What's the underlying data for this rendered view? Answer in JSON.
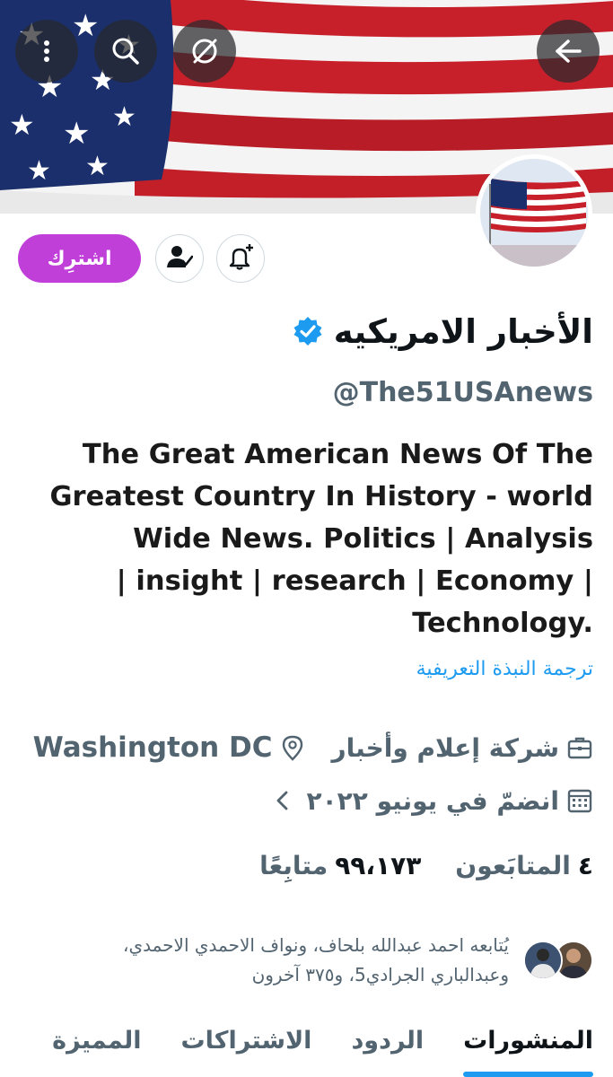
{
  "header": {
    "back_icon": "arrow-right-icon",
    "buttons": [
      "more-vertical-icon",
      "search-icon",
      "translate-off-icon"
    ]
  },
  "profile": {
    "display_name": "الأخبار الامريكيه",
    "handle": "@The51USAnews",
    "verified": true,
    "bio_lines": [
      "The Great American News Of The",
      "Greatest Country In History - world",
      "Wide News. Politics | Analysis",
      "| insight | research | Economy |",
      "Technology."
    ],
    "translate_bio": "ترجمة النبذة التعريفية",
    "category": "شركة إعلام وأخبار",
    "location": "Washington DC",
    "joined": "انضمّ في يونيو ٢٠٢٢",
    "following_count": "٤",
    "following_label": "المتابَعون",
    "followers_count": "٩٩،١٧٣",
    "followers_label": "متابِعًا",
    "followed_by": "يُتابعه احمد عبدالله بلحاف، ونواف الاحمدي الاحمدي، وعبدالباري الجرادي5، و٣٧٥ آخرون"
  },
  "actions": {
    "subscribe_label": "اشترِك"
  },
  "tabs": [
    {
      "label": "المنشورات",
      "active": true
    },
    {
      "label": "الردود",
      "active": false
    },
    {
      "label": "الاشتراكات",
      "active": false
    },
    {
      "label": "المميزة",
      "active": false
    }
  ],
  "colors": {
    "accent": "#1d9bf0",
    "subscribe": "#c13fd9",
    "text_secondary": "#536471"
  }
}
